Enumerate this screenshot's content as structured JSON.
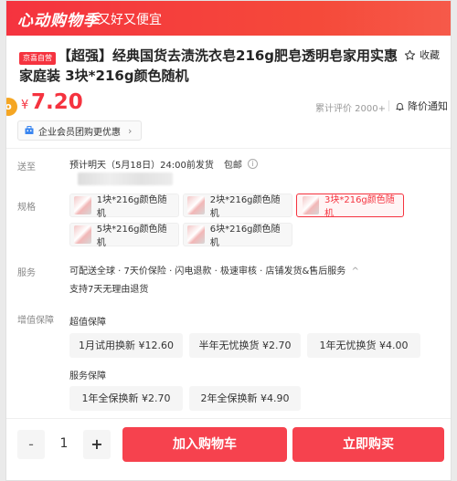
{
  "banner": {
    "logo": "心动购物季",
    "slogan": "又好又便宜"
  },
  "product": {
    "tag": "京喜自营",
    "title": "【超强】经典国货去渍洗衣皂216g肥皂透明皂家用实惠家庭装 3块*216g颜色随机",
    "favorite_label": "收藏",
    "price_symbol": "¥",
    "price": "7.20",
    "coupon_badge": "o",
    "reviews": "累计评价 2000+",
    "price_notify": "降价通知",
    "enterprise": "企业会员团购更优惠"
  },
  "delivery": {
    "label": "送至",
    "eta": "预计明天（5月18日）24:00前发货",
    "shipping": "包邮",
    "info_icon": "i"
  },
  "spec": {
    "label": "规格",
    "options": [
      {
        "label": "1块*216g颜色随机",
        "selected": false
      },
      {
        "label": "2块*216g颜色随机",
        "selected": false
      },
      {
        "label": "3块*216g颜色随机",
        "selected": true
      },
      {
        "label": "5块*216g颜色随机",
        "selected": false
      },
      {
        "label": "6块*216g颜色随机",
        "selected": false
      }
    ]
  },
  "service": {
    "label": "服务",
    "line1": "可配送全球 · 7天价保险 · 闪电退款 · 极速审核 · 店铺发货&售后服务",
    "chevron": "^",
    "line2": "支持7天无理由退货"
  },
  "guarantee": {
    "label": "增值保障",
    "group1_title": "超值保障",
    "group1": [
      "1月试用换新 ¥12.60",
      "半年无忧换货 ¥2.70",
      "1年无忧换货 ¥4.00"
    ],
    "group2_title": "服务保障",
    "group2": [
      "1年全保换新 ¥2.70",
      "2年全保换新 ¥4.90"
    ]
  },
  "bottom": {
    "minus": "-",
    "quantity": "1",
    "plus": "+",
    "add_to_cart": "加入购物车",
    "buy_now": "立即购买"
  },
  "colors": {
    "accent": "#f5333f",
    "button": "#f6424e"
  }
}
